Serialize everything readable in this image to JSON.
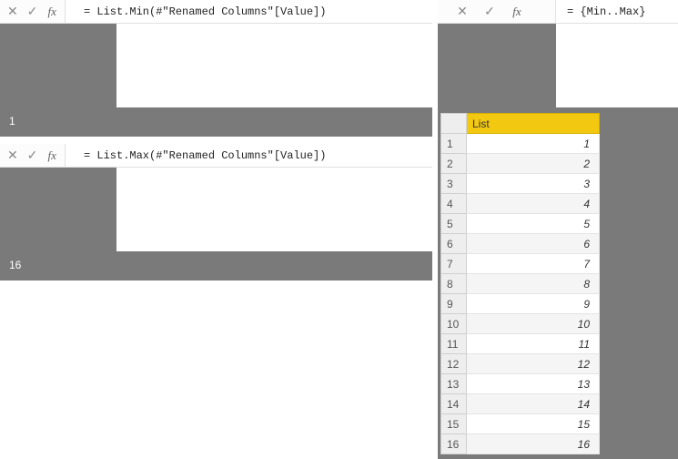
{
  "panels": {
    "min": {
      "formula": "= List.Min(#\"Renamed Columns\"[Value])",
      "result": "1"
    },
    "max": {
      "formula": "= List.Max(#\"Renamed Columns\"[Value])",
      "result": "16"
    },
    "range": {
      "formula": "= {Min..Max}",
      "header": "List",
      "rows": [
        {
          "idx": "1",
          "val": "1"
        },
        {
          "idx": "2",
          "val": "2"
        },
        {
          "idx": "3",
          "val": "3"
        },
        {
          "idx": "4",
          "val": "4"
        },
        {
          "idx": "5",
          "val": "5"
        },
        {
          "idx": "6",
          "val": "6"
        },
        {
          "idx": "7",
          "val": "7"
        },
        {
          "idx": "8",
          "val": "8"
        },
        {
          "idx": "9",
          "val": "9"
        },
        {
          "idx": "10",
          "val": "10"
        },
        {
          "idx": "11",
          "val": "11"
        },
        {
          "idx": "12",
          "val": "12"
        },
        {
          "idx": "13",
          "val": "13"
        },
        {
          "idx": "14",
          "val": "14"
        },
        {
          "idx": "15",
          "val": "15"
        },
        {
          "idx": "16",
          "val": "16"
        }
      ]
    }
  },
  "icons": {
    "cancel": "✕",
    "confirm": "✓",
    "fx": "fx"
  }
}
